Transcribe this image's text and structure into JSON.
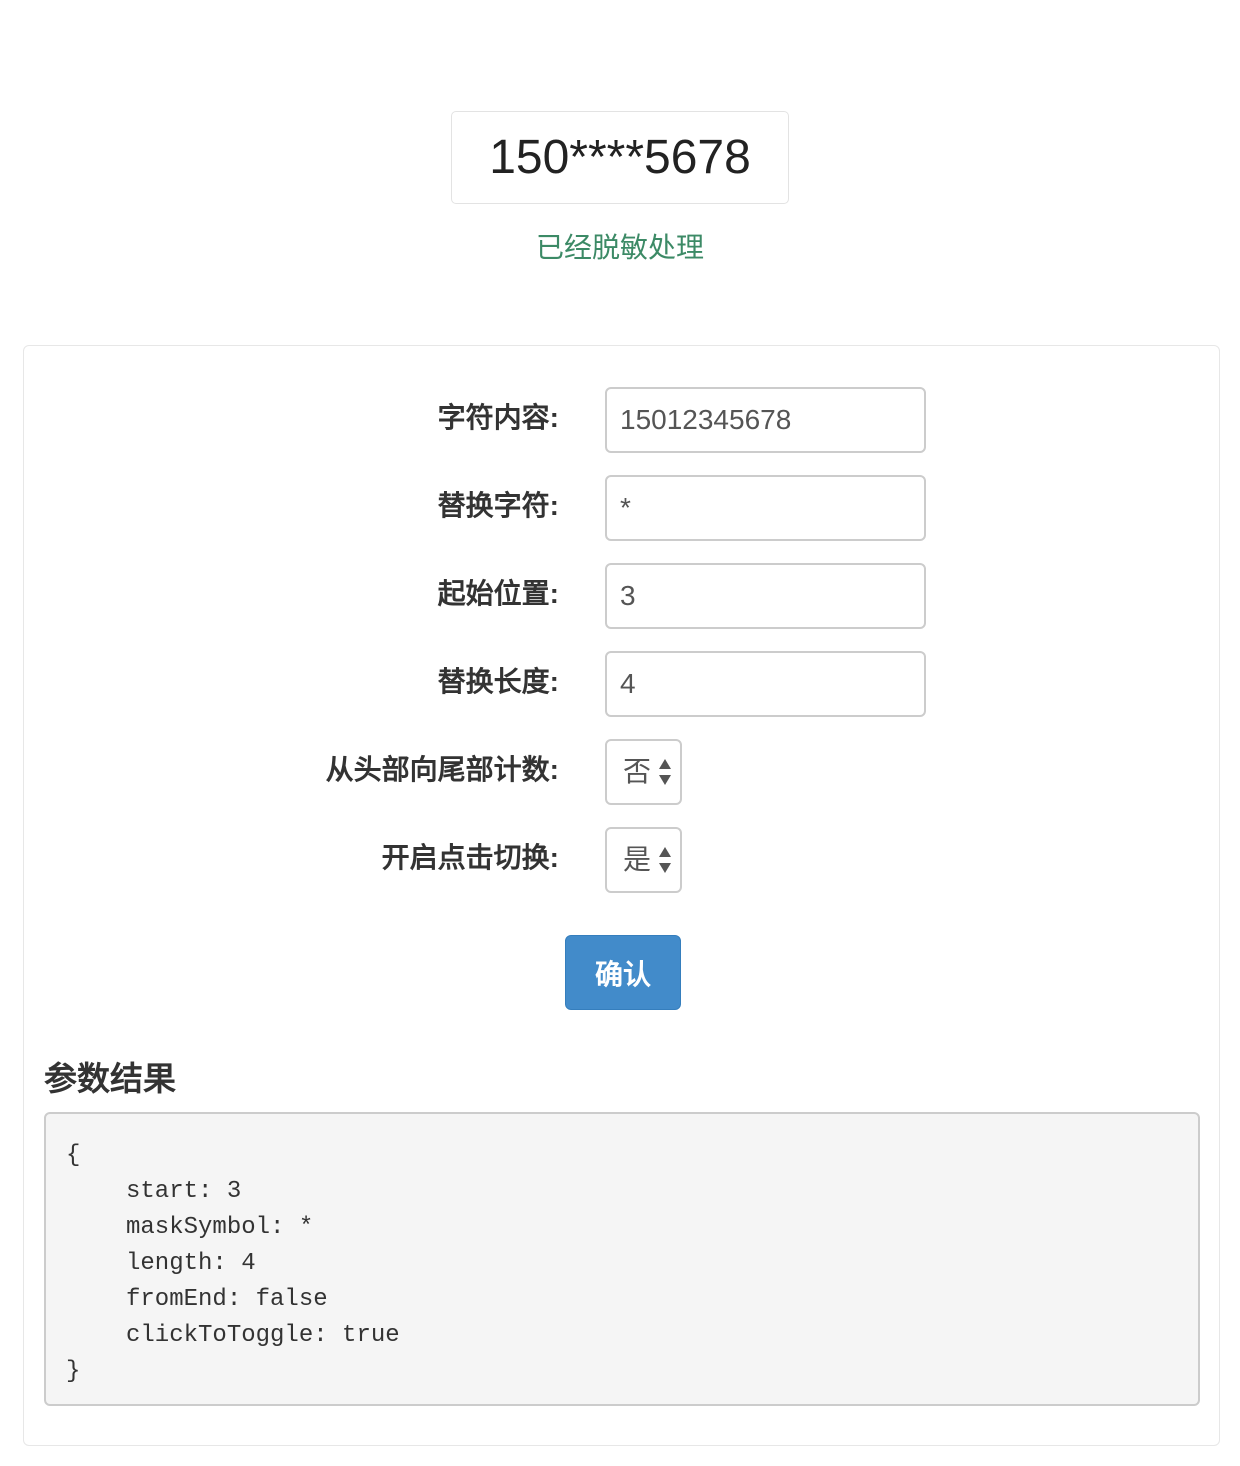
{
  "display": {
    "masked_value": "150****5678",
    "status_text": "已经脱敏处理"
  },
  "form": {
    "content_label": "字符内容:",
    "content_value": "15012345678",
    "mask_symbol_label": "替换字符:",
    "mask_symbol_value": "*",
    "start_label": "起始位置:",
    "start_value": "3",
    "length_label": "替换长度:",
    "length_value": "4",
    "from_end_label": "从头部向尾部计数:",
    "from_end_selected": "否",
    "click_toggle_label": "开启点击切换:",
    "click_toggle_selected": "是",
    "confirm_label": "确认"
  },
  "result": {
    "title": "参数结果",
    "open_brace": "{",
    "lines": [
      "start: 3",
      "maskSymbol: *",
      "length: 4",
      "fromEnd: false",
      "clickToToggle: true"
    ],
    "close_brace": "}"
  },
  "colors": {
    "status_green": "#3c8a66",
    "button_blue": "#428bca",
    "code_bg": "#f5f5f5"
  },
  "icons": {
    "select_arrow": "up-down-triangle-icon"
  }
}
